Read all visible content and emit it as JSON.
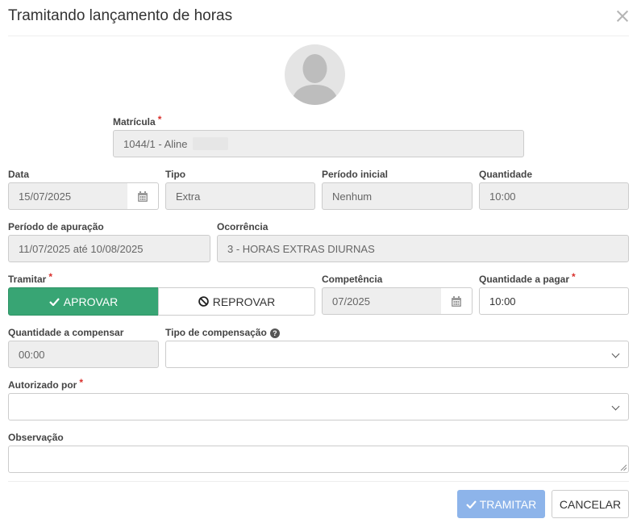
{
  "modal": {
    "title": "Tramitando lançamento de horas"
  },
  "matricula": {
    "label": "Matrícula",
    "required_mark": "*",
    "value": "1044/1 - Aline"
  },
  "data": {
    "label": "Data",
    "value": "15/07/2025"
  },
  "tipo": {
    "label": "Tipo",
    "value": "Extra"
  },
  "periodo_inicial": {
    "label": "Período inicial",
    "value": "Nenhum"
  },
  "quantidade": {
    "label": "Quantidade",
    "value": "10:00"
  },
  "periodo_apuracao": {
    "label": "Período de apuração",
    "value": "11/07/2025 até 10/08/2025"
  },
  "ocorrencia": {
    "label": "Ocorrência",
    "value": "3 - HORAS EXTRAS DIURNAS"
  },
  "tramitar": {
    "label": "Tramitar",
    "required_mark": "*",
    "approve_label": "APROVAR",
    "reject_label": "REPROVAR",
    "selected": "APROVAR"
  },
  "competencia": {
    "label": "Competência",
    "value": "07/2025"
  },
  "quantidade_pagar": {
    "label": "Quantidade a pagar",
    "required_mark": "*",
    "value": "10:00"
  },
  "quantidade_compensar": {
    "label": "Quantidade a compensar",
    "value": "00:00"
  },
  "tipo_compensacao": {
    "label": "Tipo de compensação",
    "help_icon": "?",
    "value": ""
  },
  "autorizado_por": {
    "label": "Autorizado por",
    "required_mark": "*",
    "value": ""
  },
  "observacao": {
    "label": "Observação",
    "value": ""
  },
  "footer": {
    "submit_label": "TRAMITAR",
    "cancel_label": "CANCELAR"
  },
  "icons": {
    "close": "close-icon",
    "avatar": "user-silhouette-icon",
    "calendar": "calendar-icon",
    "check": "check-icon",
    "ban": "ban-icon",
    "chevron": "chevron-down-icon",
    "help": "question-circle-icon"
  },
  "colors": {
    "approve": "#38a574",
    "submit_disabled": "#8db4ea",
    "required": "#d9302c",
    "readonly_bg": "#eeeeee"
  }
}
